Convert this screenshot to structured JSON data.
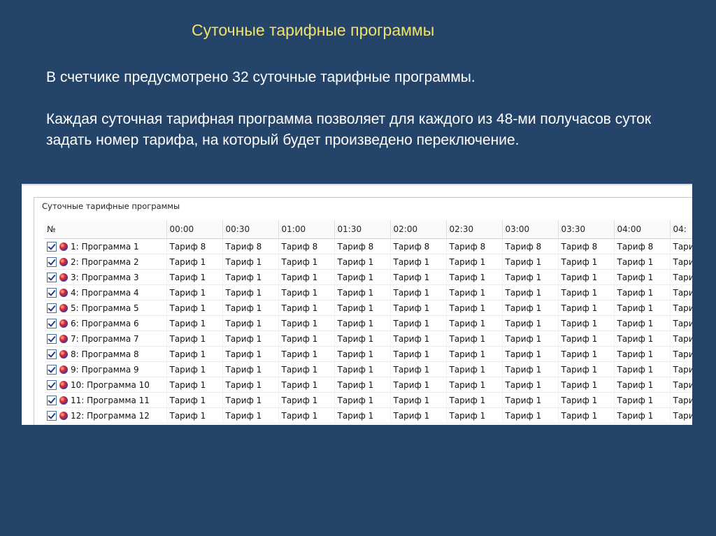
{
  "slide": {
    "title": "Суточные тарифные программы",
    "paragraph1": "В счетчике предусмотрено 32 суточные тарифные программы.",
    "paragraph2": "Каждая суточная тарифная программа позволяет для каждого из 48-ми получасов суток задать номер тарифа, на который будет произведено переключение."
  },
  "window": {
    "group_title": "Суточные тарифные программы",
    "columns": [
      "№",
      "00:00",
      "00:30",
      "01:00",
      "01:30",
      "02:00",
      "02:30",
      "03:00",
      "03:30",
      "04:00",
      "04:"
    ],
    "rows": [
      {
        "label": "1: Программа 1",
        "checked": true,
        "cells": [
          "Тариф 8",
          "Тариф 8",
          "Тариф 8",
          "Тариф 8",
          "Тариф 8",
          "Тариф 8",
          "Тариф 8",
          "Тариф 8",
          "Тариф 8",
          "Тариф"
        ]
      },
      {
        "label": "2: Программа 2",
        "checked": true,
        "cells": [
          "Тариф 1",
          "Тариф 1",
          "Тариф 1",
          "Тариф 1",
          "Тариф 1",
          "Тариф 1",
          "Тариф 1",
          "Тариф 1",
          "Тариф 1",
          "Тариф"
        ]
      },
      {
        "label": "3: Программа 3",
        "checked": true,
        "cells": [
          "Тариф 1",
          "Тариф 1",
          "Тариф 1",
          "Тариф 1",
          "Тариф 1",
          "Тариф 1",
          "Тариф 1",
          "Тариф 1",
          "Тариф 1",
          "Тариф"
        ]
      },
      {
        "label": "4: Программа 4",
        "checked": true,
        "cells": [
          "Тариф 1",
          "Тариф 1",
          "Тариф 1",
          "Тариф 1",
          "Тариф 1",
          "Тариф 1",
          "Тариф 1",
          "Тариф 1",
          "Тариф 1",
          "Тариф"
        ]
      },
      {
        "label": "5: Программа 5",
        "checked": true,
        "cells": [
          "Тариф 1",
          "Тариф 1",
          "Тариф 1",
          "Тариф 1",
          "Тариф 1",
          "Тариф 1",
          "Тариф 1",
          "Тариф 1",
          "Тариф 1",
          "Тариф"
        ]
      },
      {
        "label": "6: Программа 6",
        "checked": true,
        "cells": [
          "Тариф 1",
          "Тариф 1",
          "Тариф 1",
          "Тариф 1",
          "Тариф 1",
          "Тариф 1",
          "Тариф 1",
          "Тариф 1",
          "Тариф 1",
          "Тариф"
        ]
      },
      {
        "label": "7: Программа 7",
        "checked": true,
        "cells": [
          "Тариф 1",
          "Тариф 1",
          "Тариф 1",
          "Тариф 1",
          "Тариф 1",
          "Тариф 1",
          "Тариф 1",
          "Тариф 1",
          "Тариф 1",
          "Тариф"
        ]
      },
      {
        "label": "8: Программа 8",
        "checked": true,
        "cells": [
          "Тариф 1",
          "Тариф 1",
          "Тариф 1",
          "Тариф 1",
          "Тариф 1",
          "Тариф 1",
          "Тариф 1",
          "Тариф 1",
          "Тариф 1",
          "Тариф"
        ]
      },
      {
        "label": "9: Программа 9",
        "checked": true,
        "cells": [
          "Тариф 1",
          "Тариф 1",
          "Тариф 1",
          "Тариф 1",
          "Тариф 1",
          "Тариф 1",
          "Тариф 1",
          "Тариф 1",
          "Тариф 1",
          "Тариф"
        ]
      },
      {
        "label": "10: Программа 10",
        "checked": true,
        "cells": [
          "Тариф 1",
          "Тариф 1",
          "Тариф 1",
          "Тариф 1",
          "Тариф 1",
          "Тариф 1",
          "Тариф 1",
          "Тариф 1",
          "Тариф 1",
          "Тариф"
        ]
      },
      {
        "label": "11: Программа 11",
        "checked": true,
        "cells": [
          "Тариф 1",
          "Тариф 1",
          "Тариф 1",
          "Тариф 1",
          "Тариф 1",
          "Тариф 1",
          "Тариф 1",
          "Тариф 1",
          "Тариф 1",
          "Тариф"
        ]
      },
      {
        "label": "12: Программа 12",
        "checked": true,
        "cells": [
          "Тариф 1",
          "Тариф 1",
          "Тариф 1",
          "Тариф 1",
          "Тариф 1",
          "Тариф 1",
          "Тариф 1",
          "Тариф 1",
          "Тариф 1",
          "Тариф"
        ]
      }
    ],
    "icons": {
      "row_checkbox": "checkbox-checked-icon",
      "row_status": "red-blue-ball-icon"
    }
  }
}
